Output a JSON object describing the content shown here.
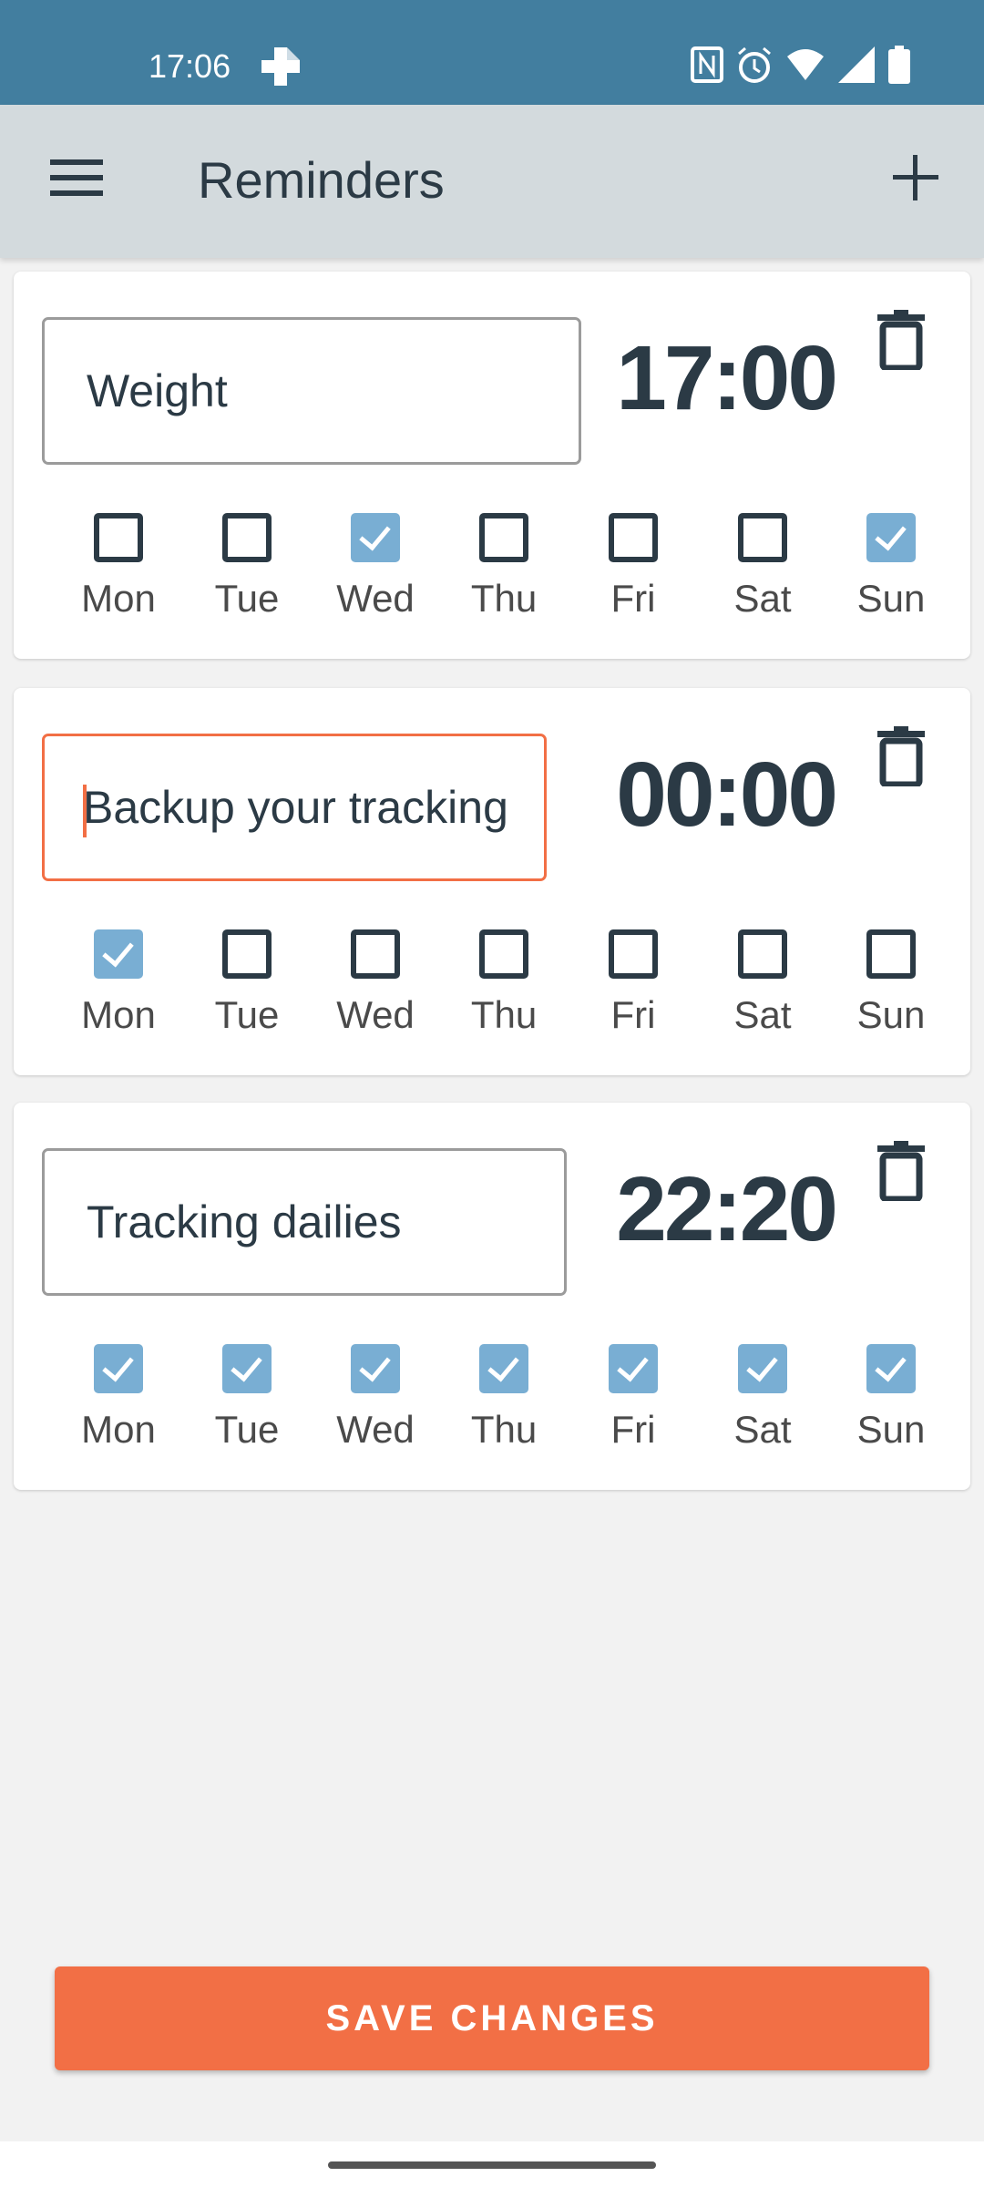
{
  "status_bar": {
    "time": "17:06"
  },
  "app_bar": {
    "title": "Reminders"
  },
  "reminders": [
    {
      "name": "Weight",
      "time": "17:00",
      "focused": false,
      "days": [
        {
          "label": "Mon",
          "checked": false
        },
        {
          "label": "Tue",
          "checked": false
        },
        {
          "label": "Wed",
          "checked": true
        },
        {
          "label": "Thu",
          "checked": false
        },
        {
          "label": "Fri",
          "checked": false
        },
        {
          "label": "Sat",
          "checked": false
        },
        {
          "label": "Sun",
          "checked": true
        }
      ]
    },
    {
      "name": "Backup your tracking",
      "time": "00:00",
      "focused": true,
      "days": [
        {
          "label": "Mon",
          "checked": true
        },
        {
          "label": "Tue",
          "checked": false
        },
        {
          "label": "Wed",
          "checked": false
        },
        {
          "label": "Thu",
          "checked": false
        },
        {
          "label": "Fri",
          "checked": false
        },
        {
          "label": "Sat",
          "checked": false
        },
        {
          "label": "Sun",
          "checked": false
        }
      ]
    },
    {
      "name": "Tracking dailies",
      "time": "22:20",
      "focused": false,
      "days": [
        {
          "label": "Mon",
          "checked": true
        },
        {
          "label": "Tue",
          "checked": true
        },
        {
          "label": "Wed",
          "checked": true
        },
        {
          "label": "Thu",
          "checked": true
        },
        {
          "label": "Fri",
          "checked": true
        },
        {
          "label": "Sat",
          "checked": true
        },
        {
          "label": "Sun",
          "checked": true
        }
      ]
    }
  ],
  "save_label": "SAVE CHANGES",
  "colors": {
    "status_bar": "#427e9f",
    "app_bar": "#d3dadd",
    "accent": "#f26f45",
    "checked": "#79aed3",
    "text": "#2b3a45"
  }
}
